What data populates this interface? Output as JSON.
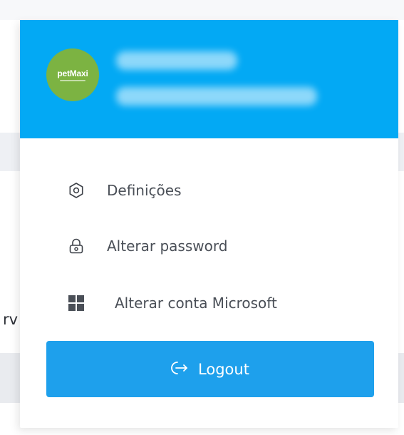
{
  "background": {
    "cut_text": "rv"
  },
  "user": {
    "avatar_brand": "petMaxi",
    "avatar_color": "#7cb342",
    "header_color": "#03a9f4"
  },
  "menu": {
    "items": [
      {
        "label": "Definições",
        "icon": "settings-hexagon-icon"
      },
      {
        "label": "Alterar password",
        "icon": "lock-icon"
      },
      {
        "label": "Alterar conta Microsoft",
        "icon": "microsoft-logo-icon"
      }
    ]
  },
  "logout": {
    "label": "Logout",
    "icon": "logout-arrow-icon",
    "color": "#1ea0ec"
  }
}
